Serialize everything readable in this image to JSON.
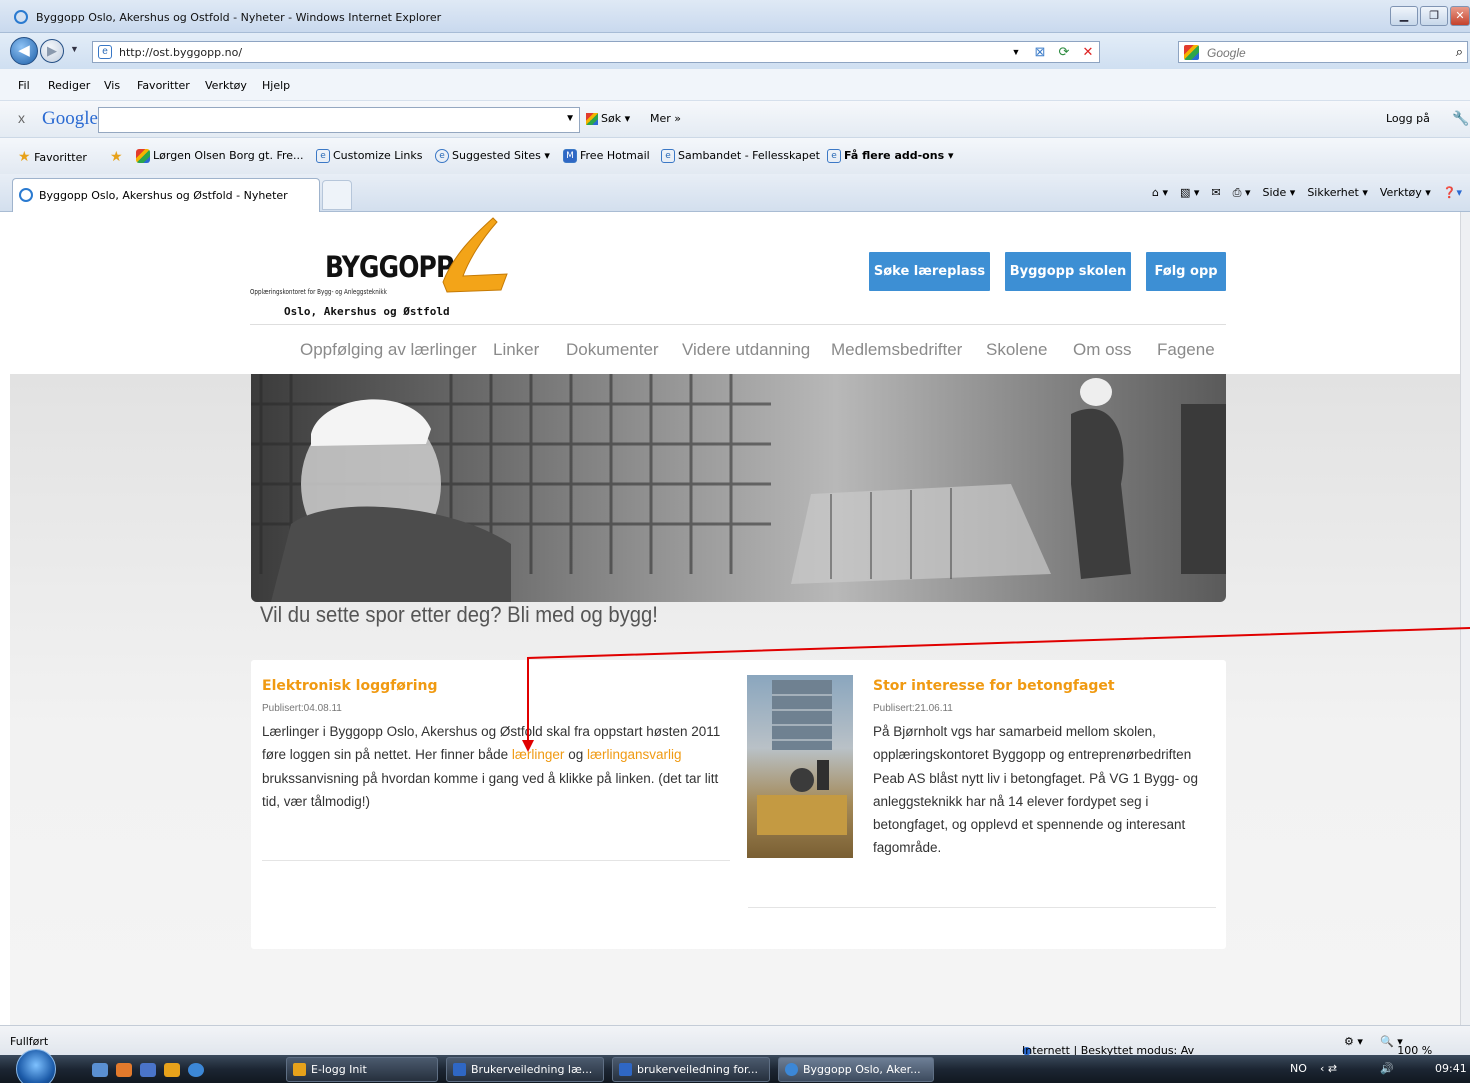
{
  "window": {
    "title": "Byggopp Oslo, Akershus og Ostfold - Nyheter - Windows Internet Explorer",
    "url": "http://ost.byggopp.no/",
    "search_placeholder": "Google"
  },
  "menu": [
    "Fil",
    "Rediger",
    "Vis",
    "Favoritter",
    "Verktøy",
    "Hjelp"
  ],
  "google_toolbar": {
    "logo": "Google",
    "search_label": "Søk",
    "more_label": "Mer",
    "signin_label": "Logg på"
  },
  "favorites": {
    "label": "Favoritter",
    "items": [
      "Lørgen Olsen Borg gt. Fre...",
      "Customize Links",
      "Suggested Sites ▾",
      "Free Hotmail",
      "Sambandet - Fellesskapet",
      "Få flere add-ons ▾"
    ]
  },
  "tab": {
    "title": "Byggopp Oslo, Akershus og Østfold - Nyheter"
  },
  "command_bar": [
    "Side ▾",
    "Sikkerhet ▾",
    "Verktøy ▾"
  ],
  "site": {
    "logo_word": "BYGGOPP",
    "logo_sub1": "Opplæringskontoret for Bygg- og Anleggsteknikk",
    "logo_sub2": "Oslo, Akershus og Østfold",
    "buttons": [
      "Søke læreplass",
      "Byggopp skolen",
      "Følg opp"
    ],
    "nav": [
      "Oppfølging av lærlinger",
      "Linker",
      "Dokumenter",
      "Videre utdanning",
      "Medlemsbedrifter",
      "Skolene",
      "Om oss",
      "Fagene"
    ],
    "tagline": "Vil du sette spor etter deg? Bli med og bygg!"
  },
  "articles": [
    {
      "title": "Elektronisk loggføring",
      "published": "Publisert:04.08.11",
      "body_a": "Lærlinger i Byggopp Oslo, Akershus og Østfold skal fra oppstart høsten 2011 føre loggen sin på nettet. Her finner både ",
      "link1": "lærlinger",
      "mid": " og ",
      "link2": "lærlingansvarlig",
      "body_b": " brukssanvisning på hvordan komme i gang ved å klikke på linken. (det tar litt tid, vær tålmodig!)"
    },
    {
      "title": "Stor interesse for betongfaget",
      "published": "Publisert:21.06.11",
      "body": "På Bjørnholt vgs har samarbeid mellom skolen, opplæringskontoret Byggopp og entreprenørbedriften Peab AS blåst nytt liv i betongfaget. På VG 1 Bygg- og anleggsteknikk har nå 14 elever fordypet seg i betongfaget, og opplevd et spennende og interesant fagområde."
    }
  ],
  "status": {
    "left": "Fullført",
    "zone": "Internett | Beskyttet modus: Av",
    "zoom": "100 %"
  },
  "taskbar": {
    "items": [
      "E-logg Init",
      "Brukerveiledning læ...",
      "brukerveiledning for...",
      "Byggopp Oslo, Aker..."
    ],
    "lang": "NO",
    "clock": "09:41"
  },
  "colors": {
    "accent": "#3d8fd4",
    "orange": "#f09a12",
    "annotation_arrow": "#e00000"
  }
}
